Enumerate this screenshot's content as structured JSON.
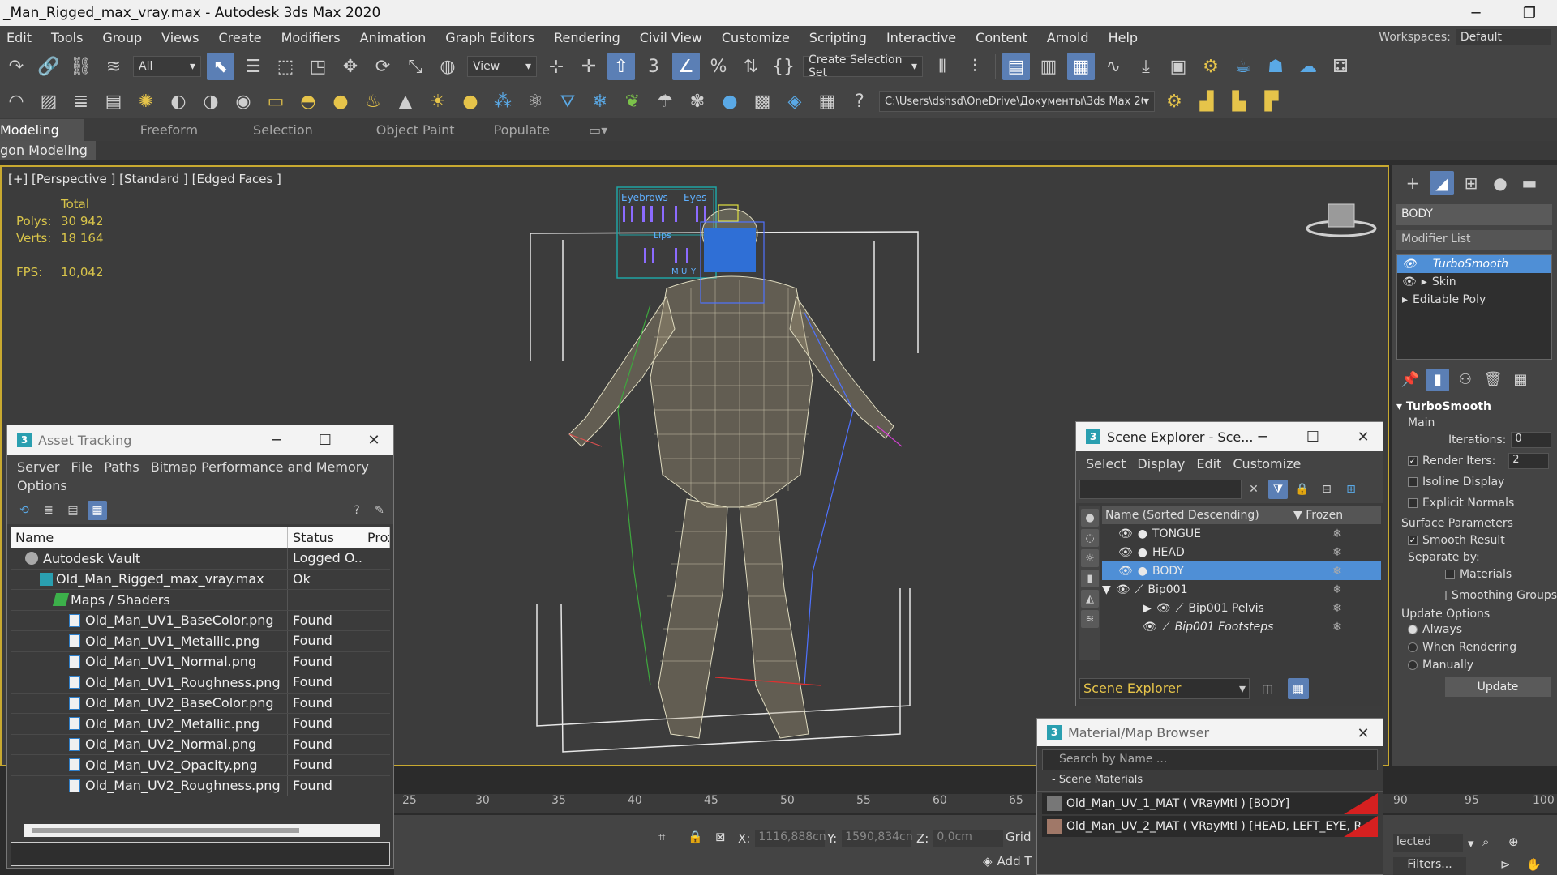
{
  "window": {
    "title": "_Man_Rigged_max_vray.max - Autodesk 3ds Max 2020",
    "minimize": "─",
    "restore": "❐"
  },
  "menu": [
    "Edit",
    "Tools",
    "Group",
    "Views",
    "Create",
    "Modifiers",
    "Animation",
    "Graph Editors",
    "Rendering",
    "Civil View",
    "Customize",
    "Scripting",
    "Interactive",
    "Content",
    "Arnold",
    "Help"
  ],
  "workspace": {
    "label": "Workspaces:",
    "value": "Default"
  },
  "toolbar": {
    "filter_value": "All",
    "view_value": "View",
    "selection_set": "Create Selection Set",
    "path": "C:\\Users\\dshsd\\OneDrive\\Документы\\3ds Max 2020",
    "snap_label": "3"
  },
  "ribbon": {
    "tabs": [
      "Modeling",
      "Freeform",
      "Selection",
      "Object Paint",
      "Populate"
    ],
    "sub": "gon Modeling"
  },
  "viewport": {
    "label": "[+] [Perspective ] [Standard ] [Edged Faces ]",
    "stats_header": "Total",
    "stats": [
      {
        "k": "Polys:",
        "v": "30 942"
      },
      {
        "k": "Verts:",
        "v": "18 164"
      },
      {
        "k": "",
        "v": ""
      },
      {
        "k": "FPS:",
        "v": "10,042"
      }
    ],
    "rig_labels": {
      "eyebrows": "Eyebrows",
      "eyes": "Eyes",
      "lips": "Lips",
      "m": "M",
      "u": "U",
      "y": "Y"
    }
  },
  "command_panel": {
    "object_name": "BODY",
    "modifier_list": "Modifier List",
    "stack": [
      "TurboSmooth",
      "Skin",
      "Editable Poly"
    ],
    "rollout_title": "TurboSmooth",
    "main": "Main",
    "iterations_label": "Iterations:",
    "iterations": "0",
    "render_iters_label": "Render Iters:",
    "render_iters": "2",
    "isoline": "Isoline Display",
    "explicit_normals": "Explicit Normals",
    "surface_params": "Surface Parameters",
    "smooth_result": "Smooth Result",
    "separate_by": "Separate by:",
    "materials": "Materials",
    "smoothing_groups": "Smoothing Groups",
    "update_options": "Update Options",
    "always": "Always",
    "when_rendering": "When Rendering",
    "manually": "Manually",
    "update_button": "Update"
  },
  "asset_tracking": {
    "title": "Asset Tracking",
    "menu": [
      "Server",
      "File",
      "Paths",
      "Bitmap Performance and Memory",
      "Options"
    ],
    "columns": [
      "Name",
      "Status",
      "Prox"
    ],
    "rows": [
      {
        "name": "Autodesk Vault",
        "status": "Logged O...",
        "level": 1,
        "icon": "vault"
      },
      {
        "name": "Old_Man_Rigged_max_vray.max",
        "status": "Ok",
        "level": 2,
        "icon": "max"
      },
      {
        "name": "Maps / Shaders",
        "status": "",
        "level": 3,
        "icon": "map"
      },
      {
        "name": "Old_Man_UV1_BaseColor.png",
        "status": "Found",
        "level": 4,
        "icon": "file"
      },
      {
        "name": "Old_Man_UV1_Metallic.png",
        "status": "Found",
        "level": 4,
        "icon": "file"
      },
      {
        "name": "Old_Man_UV1_Normal.png",
        "status": "Found",
        "level": 4,
        "icon": "file"
      },
      {
        "name": "Old_Man_UV1_Roughness.png",
        "status": "Found",
        "level": 4,
        "icon": "file"
      },
      {
        "name": "Old_Man_UV2_BaseColor.png",
        "status": "Found",
        "level": 4,
        "icon": "file"
      },
      {
        "name": "Old_Man_UV2_Metallic.png",
        "status": "Found",
        "level": 4,
        "icon": "file"
      },
      {
        "name": "Old_Man_UV2_Normal.png",
        "status": "Found",
        "level": 4,
        "icon": "file"
      },
      {
        "name": "Old_Man_UV2_Opacity.png",
        "status": "Found",
        "level": 4,
        "icon": "file"
      },
      {
        "name": "Old_Man_UV2_Roughness.png",
        "status": "Found",
        "level": 4,
        "icon": "file"
      }
    ]
  },
  "scene_explorer": {
    "title": "Scene Explorer - Sce...",
    "menu": [
      "Select",
      "Display",
      "Edit",
      "Customize"
    ],
    "col_name": "Name (Sorted Descending)",
    "col_frozen": "▼ Frozen",
    "rows": [
      {
        "name": "TONGUE",
        "indent": 0,
        "selected": false,
        "italic": false
      },
      {
        "name": "HEAD",
        "indent": 0,
        "selected": false,
        "italic": false
      },
      {
        "name": "BODY",
        "indent": 0,
        "selected": true,
        "italic": false
      },
      {
        "name": "Bip001",
        "indent": 0,
        "selected": false,
        "italic": false
      },
      {
        "name": "Bip001 Pelvis",
        "indent": 1,
        "selected": false,
        "italic": false
      },
      {
        "name": "Bip001 Footsteps",
        "indent": 1,
        "selected": false,
        "italic": true
      }
    ],
    "footer": "Scene Explorer"
  },
  "material_browser": {
    "title": "Material/Map Browser",
    "search_placeholder": "Search by Name ...",
    "group": "- Scene Materials",
    "items": [
      "Old_Man_UV_1_MAT  ( VRayMtl )  [BODY]",
      "Old_Man_UV_2_MAT  ( VRayMtl )  [HEAD, LEFT_EYE, R..."
    ]
  },
  "timeline": {
    "ticks": [
      "25",
      "30",
      "35",
      "40",
      "45",
      "50",
      "55",
      "60",
      "65",
      "90",
      "95",
      "100"
    ]
  },
  "status": {
    "x_label": "X:",
    "x": "1116,888cn",
    "y_label": "Y:",
    "y": "1590,834cn",
    "z_label": "Z:",
    "z": "0,0cm",
    "grid": "Grid =",
    "add_time": "Add T",
    "selected": "lected",
    "filters": "Filters..."
  },
  "colors": {
    "accent": "#5b7fb5",
    "selection": "#4f8fd6",
    "viewport_border": "#c8a930",
    "stats": "#d8c44a"
  }
}
